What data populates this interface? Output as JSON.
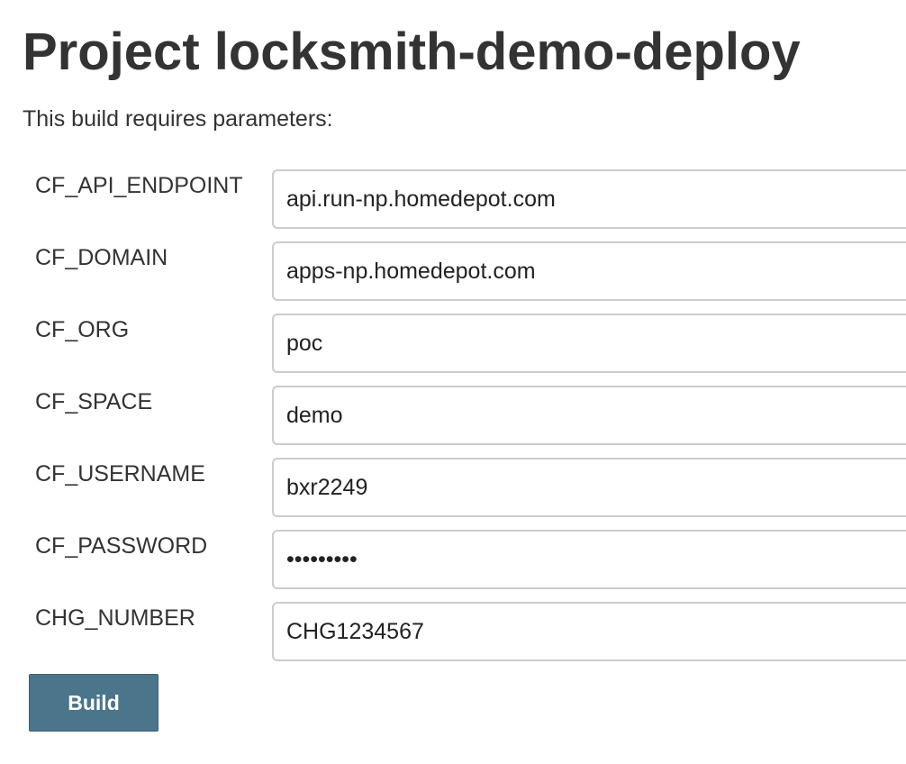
{
  "page": {
    "title": "Project locksmith-demo-deploy",
    "subtitle": "This build requires parameters:"
  },
  "parameters": [
    {
      "label": "CF_API_ENDPOINT",
      "value": "api.run-np.homedepot.com",
      "type": "text"
    },
    {
      "label": "CF_DOMAIN",
      "value": "apps-np.homedepot.com",
      "type": "text"
    },
    {
      "label": "CF_ORG",
      "value": "poc",
      "type": "text"
    },
    {
      "label": "CF_SPACE",
      "value": "demo",
      "type": "text"
    },
    {
      "label": "CF_USERNAME",
      "value": "bxr2249",
      "type": "text"
    },
    {
      "label": "CF_PASSWORD",
      "value": "•••••••••",
      "type": "password"
    },
    {
      "label": "CHG_NUMBER",
      "value": "CHG1234567",
      "type": "text"
    }
  ],
  "actions": {
    "build_label": "Build"
  },
  "colors": {
    "build_button_bg": "#4b758b",
    "text": "#333333",
    "input_border": "#cccccc"
  }
}
